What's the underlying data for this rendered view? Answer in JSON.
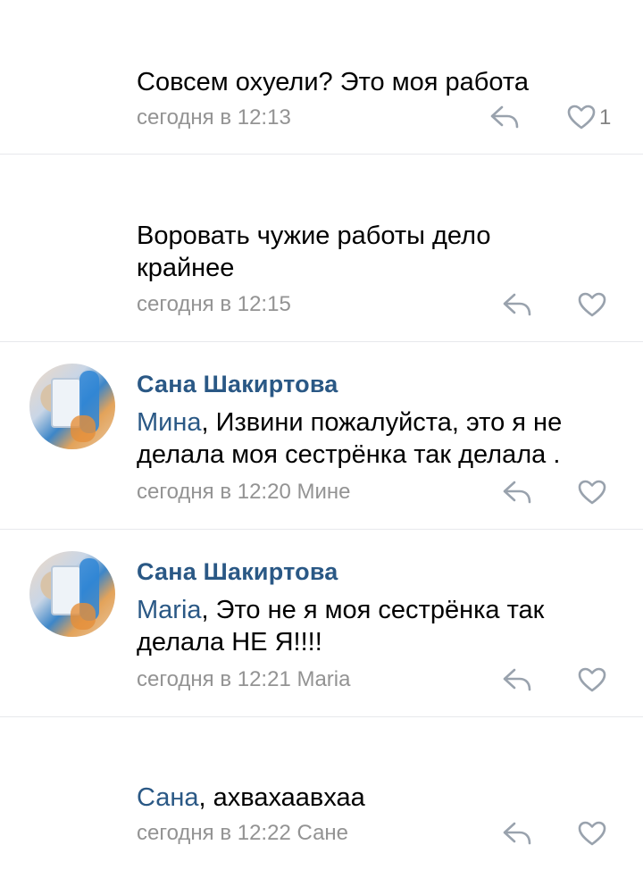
{
  "comments": [
    {
      "text": "Совсем охуели? Это моя работа",
      "time": "сегодня в 12:13",
      "likes": "1"
    },
    {
      "text": "Воровать чужие работы дело крайнее",
      "time": "сегодня в 12:15"
    },
    {
      "author": "Сана Шакиртова",
      "mention": "Мина",
      "text": ", Извини пожалуйста, это я не делала моя сестрёнка так делала .",
      "time": "сегодня в 12:20",
      "reply_to": "Мине"
    },
    {
      "author": "Сана Шакиртова",
      "mention": "Maria",
      "text": ", Это не я моя сестрёнка так делала НЕ Я!!!!",
      "time": "сегодня в 12:21",
      "reply_to": "Maria"
    },
    {
      "mention": "Сана",
      "text": ", ахвахаавхаа",
      "time": "сегодня в 12:22",
      "reply_to": "Сане"
    }
  ],
  "icons": {
    "reply": "reply-arrow-icon",
    "like": "heart-outline-icon"
  },
  "colors": {
    "link": "#2a5885",
    "meta": "#939393",
    "divider": "#e7e8ec",
    "icon": "#99a2ad"
  }
}
